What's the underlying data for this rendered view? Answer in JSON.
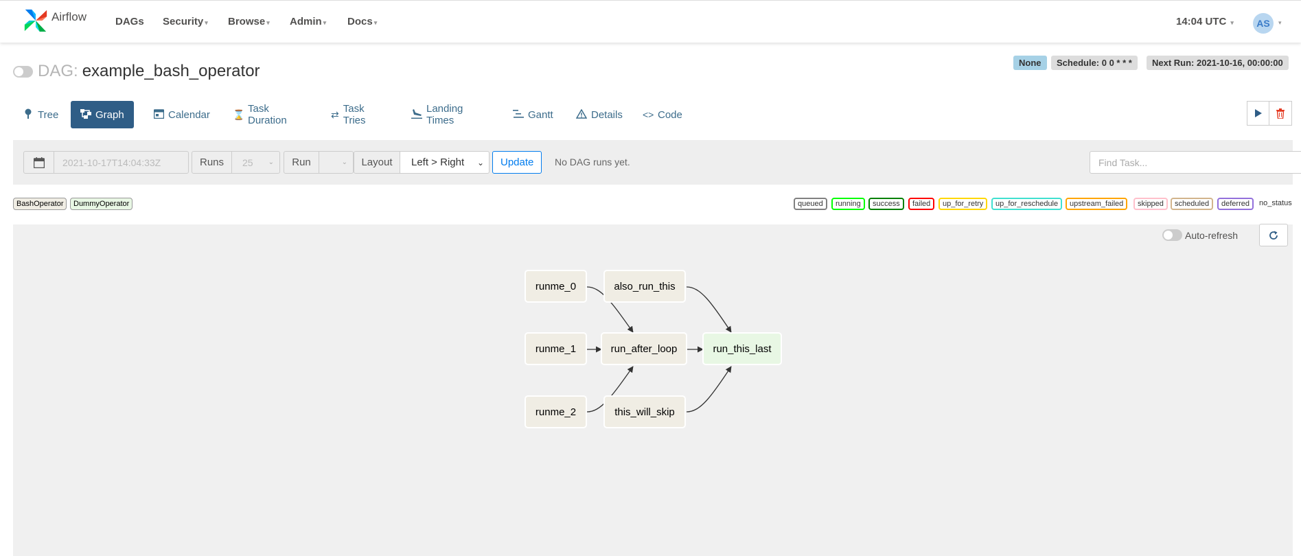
{
  "nav": {
    "brand": "Airflow",
    "items": [
      {
        "label": "DAGs",
        "has_caret": false
      },
      {
        "label": "Security",
        "has_caret": true
      },
      {
        "label": "Browse",
        "has_caret": true
      },
      {
        "label": "Admin",
        "has_caret": true
      },
      {
        "label": "Docs",
        "has_caret": true
      }
    ],
    "clock": "14:04 UTC",
    "avatar_initials": "AS"
  },
  "dag": {
    "prefix": "DAG:",
    "name": "example_bash_operator",
    "badges": {
      "status": "None",
      "schedule": "Schedule: 0 0 * * *",
      "next_run": "Next Run: 2021-10-16, 00:00:00"
    }
  },
  "tabs": [
    {
      "label": "Tree",
      "icon": "tree-icon",
      "active": false
    },
    {
      "label": "Graph",
      "icon": "graph-icon",
      "active": true
    },
    {
      "label": "Calendar",
      "icon": "calendar-icon",
      "active": false
    },
    {
      "label": "Task Duration",
      "icon": "hourglass-icon",
      "active": false
    },
    {
      "label": "Task Tries",
      "icon": "retry-icon",
      "active": false
    },
    {
      "label": "Landing Times",
      "icon": "landing-icon",
      "active": false
    },
    {
      "label": "Gantt",
      "icon": "gantt-icon",
      "active": false
    },
    {
      "label": "Details",
      "icon": "warning-icon",
      "active": false
    },
    {
      "label": "Code",
      "icon": "code-icon",
      "active": false
    }
  ],
  "filters": {
    "date": "2021-10-17T14:04:33Z",
    "runs_label": "Runs",
    "runs_value": "25",
    "run_label": "Run",
    "run_value": "",
    "layout_label": "Layout",
    "layout_value": "Left > Right",
    "update_label": "Update",
    "no_runs_text": "No DAG runs yet.",
    "find_task_placeholder": "Find Task..."
  },
  "operators": [
    {
      "label": "BashOperator",
      "color": "#f0ede4"
    },
    {
      "label": "DummyOperator",
      "color": "#e8f7e4"
    }
  ],
  "states": [
    {
      "label": "queued",
      "color": "#808080"
    },
    {
      "label": "running",
      "color": "#00ff00"
    },
    {
      "label": "success",
      "color": "#008000"
    },
    {
      "label": "failed",
      "color": "#ff0000"
    },
    {
      "label": "up_for_retry",
      "color": "#ffd700"
    },
    {
      "label": "up_for_reschedule",
      "color": "#40e0d0"
    },
    {
      "label": "upstream_failed",
      "color": "#ffa500"
    },
    {
      "label": "skipped",
      "color": "#ffc0cb"
    },
    {
      "label": "scheduled",
      "color": "#d2b48c"
    },
    {
      "label": "deferred",
      "color": "#9370db"
    }
  ],
  "no_status_label": "no_status",
  "graph": {
    "auto_refresh_label": "Auto-refresh",
    "nodes": [
      {
        "id": "runme_0",
        "label": "runme_0",
        "operator": "BashOperator"
      },
      {
        "id": "runme_1",
        "label": "runme_1",
        "operator": "BashOperator"
      },
      {
        "id": "runme_2",
        "label": "runme_2",
        "operator": "BashOperator"
      },
      {
        "id": "also_run_this",
        "label": "also_run_this",
        "operator": "BashOperator"
      },
      {
        "id": "run_after_loop",
        "label": "run_after_loop",
        "operator": "BashOperator"
      },
      {
        "id": "this_will_skip",
        "label": "this_will_skip",
        "operator": "BashOperator"
      },
      {
        "id": "run_this_last",
        "label": "run_this_last",
        "operator": "DummyOperator"
      }
    ],
    "edges": [
      [
        "runme_0",
        "run_after_loop"
      ],
      [
        "runme_1",
        "run_after_loop"
      ],
      [
        "runme_2",
        "run_after_loop"
      ],
      [
        "also_run_this",
        "run_this_last"
      ],
      [
        "run_after_loop",
        "run_this_last"
      ],
      [
        "this_will_skip",
        "run_this_last"
      ]
    ]
  }
}
